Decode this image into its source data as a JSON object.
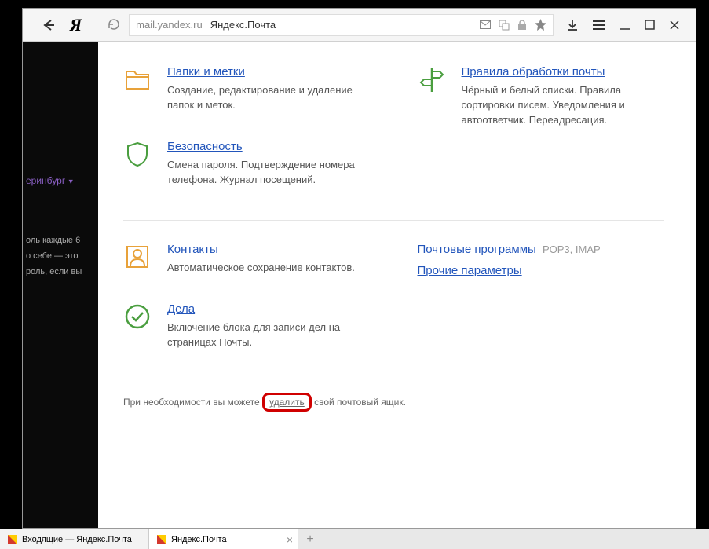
{
  "browser": {
    "url": "mail.yandex.ru",
    "page_title": "Яндекс.Почта"
  },
  "sidebar": {
    "region": "еринбург",
    "text1": "оль каждые 6",
    "text2": "о себе — это",
    "text3": "роль, если вы"
  },
  "settings": {
    "folders": {
      "title": "Папки и метки",
      "desc": "Создание, редактирование и удаление папок и меток."
    },
    "rules": {
      "title": "Правила обработки почты",
      "desc": "Чёрный и белый списки. Правила сортировки писем. Уведомления и автоответчик. Переадресация."
    },
    "security": {
      "title": "Безопасность",
      "desc": "Смена пароля. Подтверждение номера телефона. Журнал посещений."
    },
    "contacts": {
      "title": "Контакты",
      "desc": "Автоматическое сохранение контактов."
    },
    "todo": {
      "title": "Дела",
      "desc": "Включение блока для записи дел на страницах Почты."
    }
  },
  "links": {
    "mail_clients": "Почтовые программы",
    "mail_clients_suffix": "POP3, IMAP",
    "other": "Прочие параметры"
  },
  "footer": {
    "prefix": "При необходимости вы можете ",
    "delete": "удалить",
    "suffix": " свой почтовый ящик."
  },
  "tabs": {
    "tab1": "Входящие — Яндекс.Почта",
    "tab2": "Яндекс.Почта"
  }
}
